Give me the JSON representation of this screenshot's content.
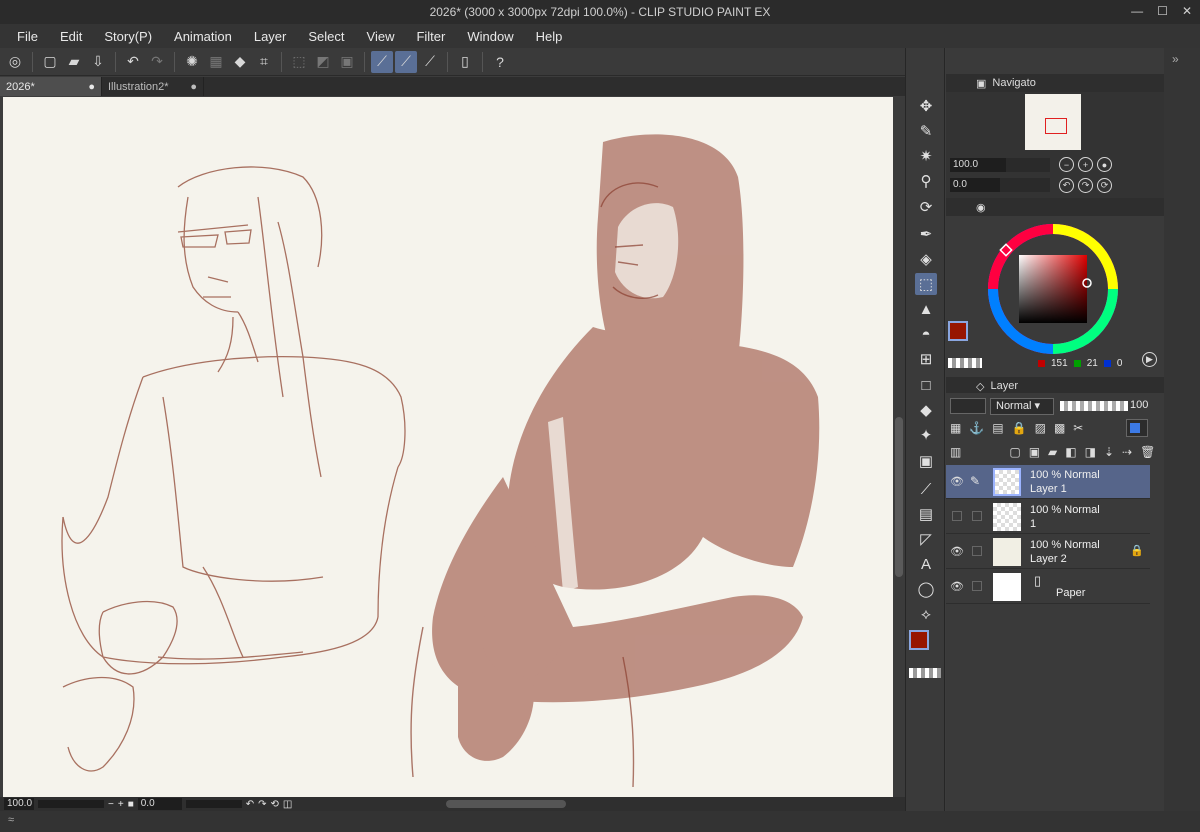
{
  "window": {
    "title": "2026* (3000 x 3000px 72dpi 100.0%)  - CLIP STUDIO PAINT EX"
  },
  "menu": [
    "File",
    "Edit",
    "Story(P)",
    "Animation",
    "Layer",
    "Select",
    "View",
    "Filter",
    "Window",
    "Help"
  ],
  "tabs": [
    {
      "label": "2026*",
      "active": true
    },
    {
      "label": "Illustration2*",
      "active": false
    }
  ],
  "status": {
    "zoom": "100.0",
    "rotation": "0.0"
  },
  "navigator": {
    "tab_label": "Navigato",
    "zoom": "100.0",
    "angle": "0.0"
  },
  "color": {
    "main": "#971500",
    "sub": "#c8c8c8",
    "r": "151",
    "g": "21",
    "b": "0",
    "r_color": "#c00000",
    "g_color": "#00a000",
    "b_color": "#0030d0"
  },
  "layer_panel": {
    "tab_label": "Layer",
    "blend_mode": "Normal",
    "opacity": "100",
    "layers": [
      {
        "mode": "100 % Normal",
        "name": "Layer 1",
        "selected": true,
        "visible": true,
        "locked": false,
        "thumb": "sketch"
      },
      {
        "mode": "100 % Normal",
        "name": "1",
        "selected": false,
        "visible": false,
        "locked": false,
        "thumb": "sketch"
      },
      {
        "mode": "100 % Normal",
        "name": "Layer 2",
        "selected": false,
        "visible": true,
        "locked": true,
        "thumb": "cream"
      },
      {
        "mode": "",
        "name": "Paper",
        "selected": false,
        "visible": true,
        "locked": false,
        "thumb": "white"
      }
    ]
  },
  "tools": [
    "move-icon",
    "eyedropper-icon",
    "magic-wand-icon",
    "zoom-icon",
    "rotate-icon",
    "pen-icon",
    "eraser-icon",
    "selection-icon",
    "fill-icon",
    "blend-icon",
    "grid-icon",
    "rectangle-icon",
    "bucket-icon",
    "sparkle-icon",
    "gradient-icon",
    "brush-icon",
    "frame-icon",
    "ruler-icon",
    "text-icon",
    "balloon-icon",
    "correct-line-icon"
  ]
}
